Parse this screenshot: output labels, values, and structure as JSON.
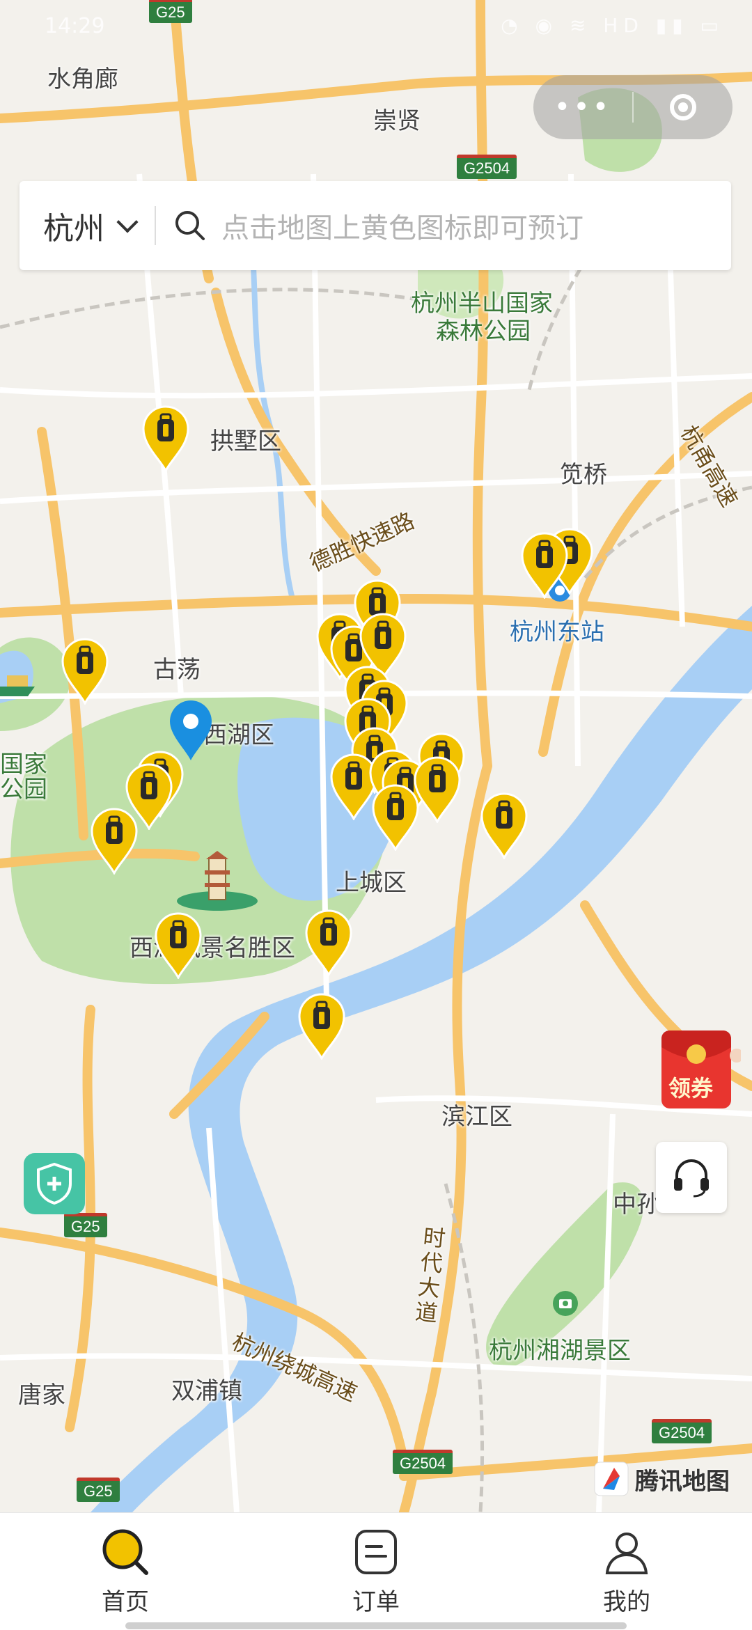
{
  "status_bar": {
    "time": "14:29",
    "icons": "◔ ◉ ≋ HD ▮▮ ▭"
  },
  "capsule": {
    "more_label": "•••"
  },
  "search": {
    "city": "杭州",
    "placeholder": "点击地图上黄色图标即可预订"
  },
  "map": {
    "places": [
      "水角廊",
      "崇贤",
      "杭州半山国家",
      "森林公园",
      "拱墅区",
      "笕桥",
      "杭州东站",
      "古荡",
      "西湖区",
      "国家",
      "公园",
      "上城区",
      "西湖风景名胜区",
      "滨江区",
      "中孙",
      "杭州湘湖景区",
      "唐家",
      "双浦镇"
    ],
    "roads": [
      "德胜快速路",
      "杭州绕城高速",
      "时代大道",
      "杭甬高速"
    ],
    "shields": [
      "G25",
      "G2504",
      "G25",
      "G25",
      "G2504",
      "G2504"
    ],
    "provider": "腾讯地图"
  },
  "floating": {
    "coupon_label": "领券"
  },
  "tabs": [
    {
      "label": "首页",
      "active": true
    },
    {
      "label": "订单",
      "active": false
    },
    {
      "label": "我的",
      "active": false
    }
  ],
  "colors": {
    "marker_yellow": "#f2c200",
    "marker_dark": "#2a2a2a",
    "location_blue": "#1a8fe0",
    "water": "#a8cff5",
    "park": "#bfe0a9"
  }
}
